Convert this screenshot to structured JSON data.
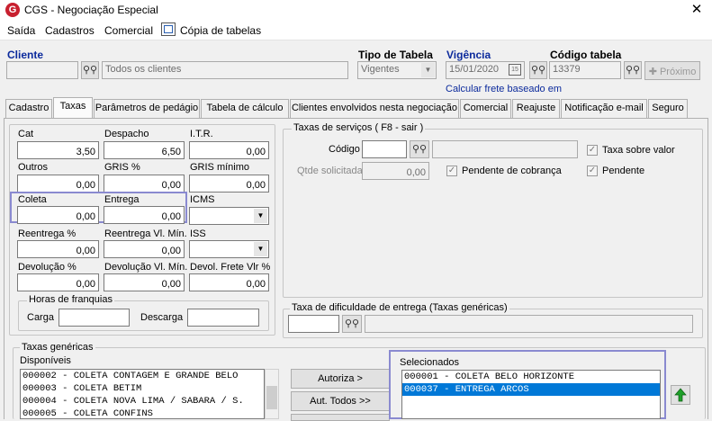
{
  "window": {
    "title": "CGS - Negociação Especial",
    "app_icon_letter": "G",
    "close_glyph": "✕"
  },
  "menu": [
    "Saída",
    "Cadastros",
    "Comercial",
    "Cópia de tabelas"
  ],
  "header": {
    "cliente_label": "Cliente",
    "cliente_code": "",
    "cliente_name": "Todos os clientes",
    "tipo_tabela_label": "Tipo de Tabela",
    "tipo_tabela_value": "Vigentes",
    "vigencia_label": "Vigência",
    "vigencia_value": "15/01/2020",
    "codigo_tabela_label": "Código tabela",
    "codigo_tabela_value": "13379",
    "proximo_label": "Próximo",
    "calc_link": "Calcular frete baseado em"
  },
  "tabs": [
    "Cadastro",
    "Taxas",
    "Parâmetros de pedágio",
    "Tabela de cálculo",
    "Clientes envolvidos nesta negociação",
    "Comercial",
    "Reajuste",
    "Notificação e-mail",
    "Seguro"
  ],
  "active_tab": "Taxas",
  "taxas": {
    "cat": {
      "label": "Cat",
      "value": "3,50"
    },
    "despacho": {
      "label": "Despacho",
      "value": "6,50"
    },
    "itr": {
      "label": "I.T.R.",
      "value": "0,00"
    },
    "outros": {
      "label": "Outros",
      "value": "0,00"
    },
    "gris_pct": {
      "label": "GRIS %",
      "value": "0,00"
    },
    "gris_min": {
      "label": "GRIS mínimo",
      "value": "0,00"
    },
    "coleta": {
      "label": "Coleta",
      "value": "0,00"
    },
    "entrega": {
      "label": "Entrega",
      "value": "0,00"
    },
    "icms": {
      "label": "ICMS",
      "value": ""
    },
    "reentrega_pct": {
      "label": "Reentrega %",
      "value": "0,00"
    },
    "reentrega_min": {
      "label": "Reentrega Vl. Mín.",
      "value": "0,00"
    },
    "iss": {
      "label": "ISS",
      "value": ""
    },
    "devolucao_pct": {
      "label": "Devolução %",
      "value": "0,00"
    },
    "devolucao_min": {
      "label": "Devolução Vl. Mín.",
      "value": "0,00"
    },
    "devol_frete": {
      "label": "Devol. Frete Vlr %",
      "value": "0,00"
    }
  },
  "franquias": {
    "legend": "Horas de franquias",
    "carga_label": "Carga",
    "carga_value": "",
    "descarga_label": "Descarga",
    "descarga_value": ""
  },
  "servicos": {
    "legend": "Taxas de serviços  ( F8 - sair )",
    "codigo_label": "Código",
    "codigo_value": "",
    "qtde_label": "Qtde solicitada",
    "qtde_value": "0,00",
    "taxa_sobre_valor": "Taxa sobre valor",
    "pendente_cobranca": "Pendente de cobrança",
    "pendente": "Pendente"
  },
  "dificuldade": {
    "legend": "Taxa de dificuldade de entrega (Taxas genéricas)"
  },
  "genericas": {
    "legend": "Taxas genéricas",
    "disponiveis_label": "Disponíveis",
    "disponiveis": [
      "000002 - COLETA CONTAGEM E GRANDE BELO",
      "000003 - COLETA BETIM",
      "000004 - COLETA NOVA LIMA / SABARA / S.",
      "000005 - COLETA CONFINS"
    ],
    "autoriza_label": "Autoriza >",
    "aut_todos_label": "Aut. Todos >>",
    "selecionados_label": "Selecionados",
    "selecionados": [
      "000001 - COLETA BELO HORIZONTE",
      "000037 - ENTREGA ARCOS"
    ]
  }
}
